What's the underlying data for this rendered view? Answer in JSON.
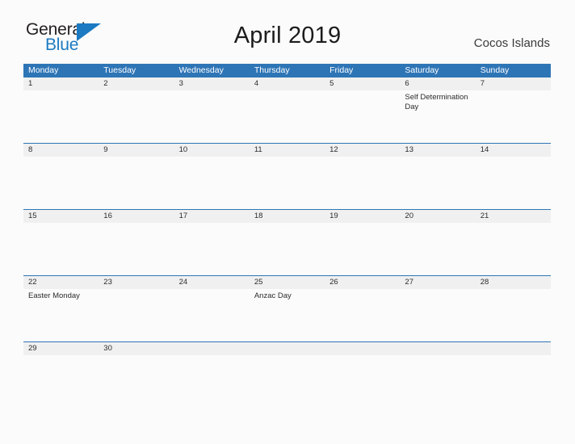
{
  "brand": {
    "name_part1": "General",
    "name_part2": "Blue",
    "accent_color": "#1b7ac2"
  },
  "header": {
    "title": "April 2019",
    "region": "Cocos Islands"
  },
  "colors": {
    "header_blue": "#2e75b6",
    "date_band_gray": "#f0f0f0",
    "page_background": "#fbfbfb",
    "text": "#2b2b2b"
  },
  "calendar": {
    "weekdays": [
      "Monday",
      "Tuesday",
      "Wednesday",
      "Thursday",
      "Friday",
      "Saturday",
      "Sunday"
    ],
    "weeks": [
      {
        "height": "tall",
        "days": [
          {
            "date": "1",
            "event": ""
          },
          {
            "date": "2",
            "event": ""
          },
          {
            "date": "3",
            "event": ""
          },
          {
            "date": "4",
            "event": ""
          },
          {
            "date": "5",
            "event": ""
          },
          {
            "date": "6",
            "event": "Self Determination Day"
          },
          {
            "date": "7",
            "event": ""
          }
        ]
      },
      {
        "height": "tall",
        "days": [
          {
            "date": "8",
            "event": ""
          },
          {
            "date": "9",
            "event": ""
          },
          {
            "date": "10",
            "event": ""
          },
          {
            "date": "11",
            "event": ""
          },
          {
            "date": "12",
            "event": ""
          },
          {
            "date": "13",
            "event": ""
          },
          {
            "date": "14",
            "event": ""
          }
        ]
      },
      {
        "height": "tall",
        "days": [
          {
            "date": "15",
            "event": ""
          },
          {
            "date": "16",
            "event": ""
          },
          {
            "date": "17",
            "event": ""
          },
          {
            "date": "18",
            "event": ""
          },
          {
            "date": "19",
            "event": ""
          },
          {
            "date": "20",
            "event": ""
          },
          {
            "date": "21",
            "event": ""
          }
        ]
      },
      {
        "height": "tall",
        "days": [
          {
            "date": "22",
            "event": "Easter Monday"
          },
          {
            "date": "23",
            "event": ""
          },
          {
            "date": "24",
            "event": ""
          },
          {
            "date": "25",
            "event": "Anzac Day"
          },
          {
            "date": "26",
            "event": ""
          },
          {
            "date": "27",
            "event": ""
          },
          {
            "date": "28",
            "event": ""
          }
        ]
      },
      {
        "height": "short",
        "days": [
          {
            "date": "29",
            "event": ""
          },
          {
            "date": "30",
            "event": ""
          },
          {
            "date": "",
            "event": ""
          },
          {
            "date": "",
            "event": ""
          },
          {
            "date": "",
            "event": ""
          },
          {
            "date": "",
            "event": ""
          },
          {
            "date": "",
            "event": ""
          }
        ]
      }
    ]
  }
}
